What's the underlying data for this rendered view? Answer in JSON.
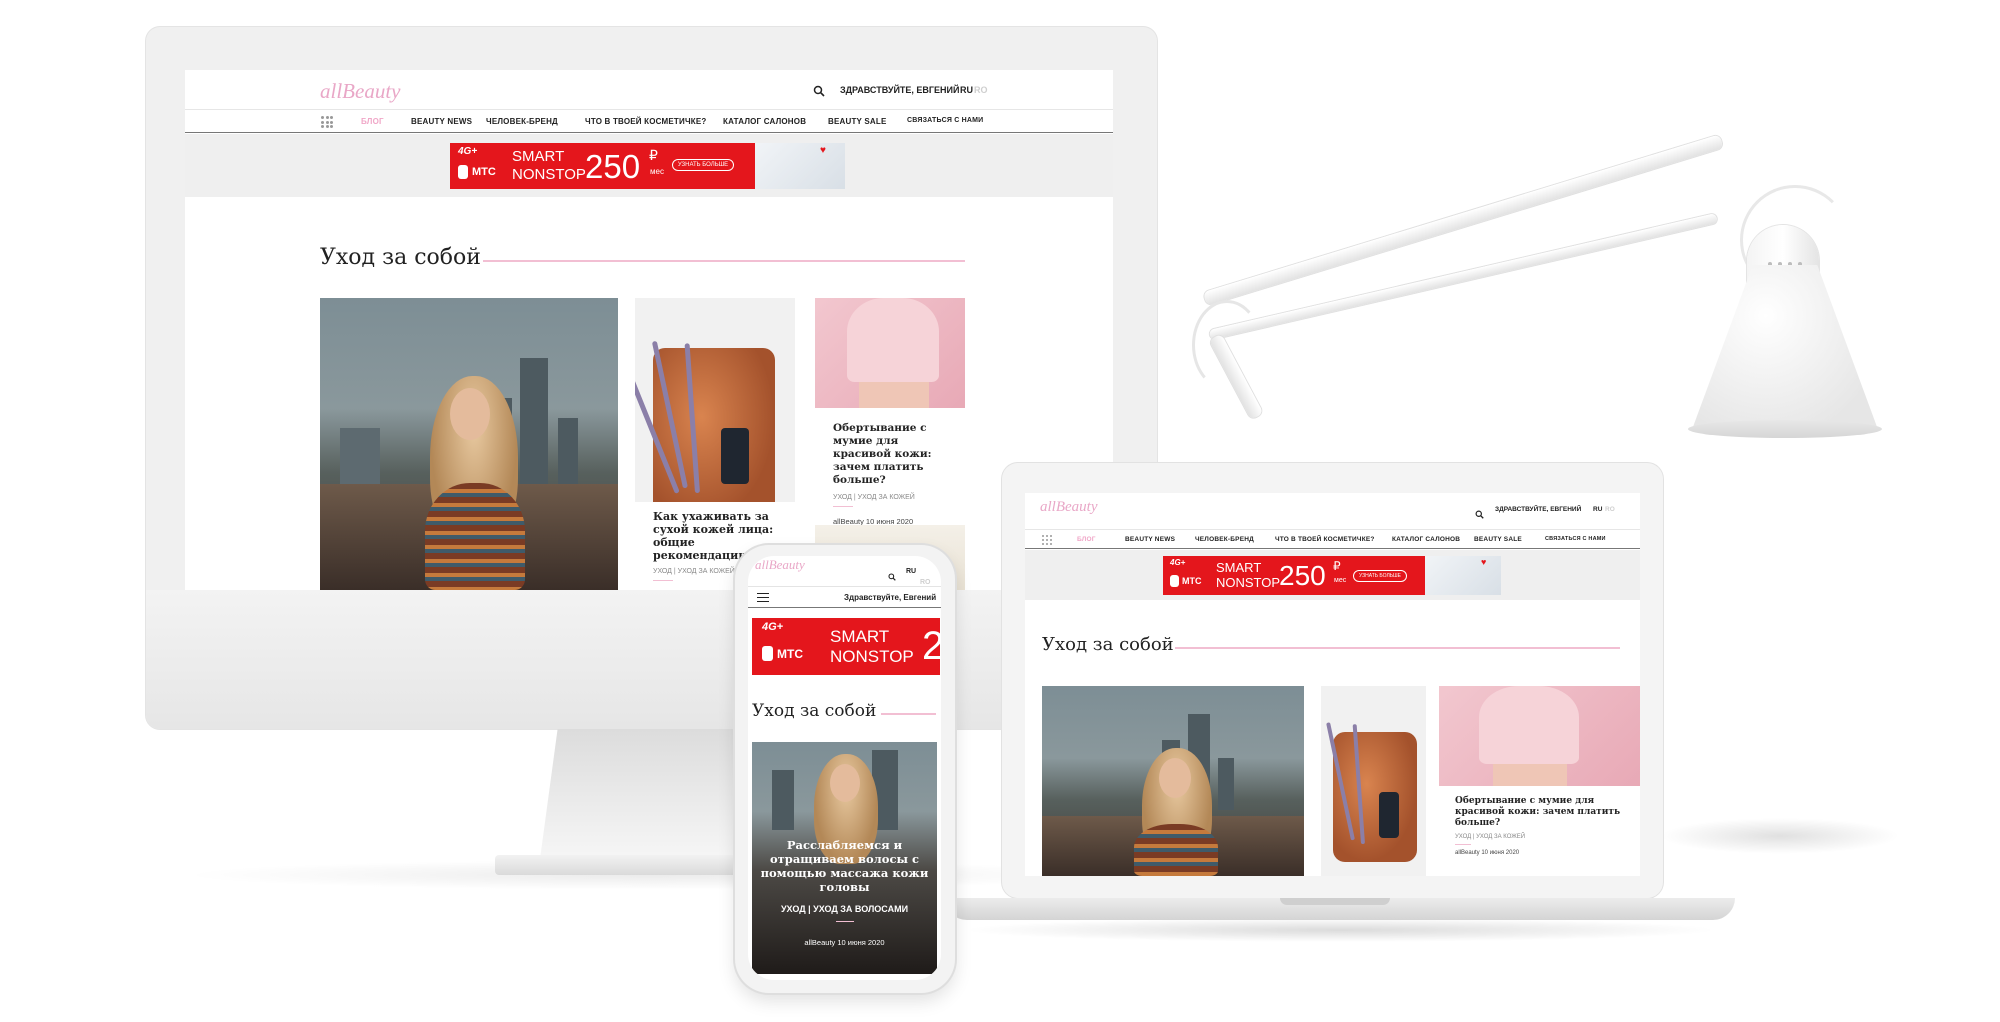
{
  "site": {
    "logo": "allBeauty",
    "greeting_upper": "ЗДРАВСТВУЙТЕ, ЕВГЕНИЙ",
    "greeting_mobile": "Здравствуйте, Евгений",
    "lang_active": "RU",
    "lang_other": "RO",
    "nav": [
      {
        "label": "БЛОГ",
        "active": true
      },
      {
        "label": "BEAUTY NEWS"
      },
      {
        "label": "ЧЕЛОВЕК-БРЕНД"
      },
      {
        "label": "ЧТО В ТВОЕЙ КОСМЕТИЧКЕ?"
      },
      {
        "label": "КАТАЛОГ САЛОНОВ"
      },
      {
        "label": "BEAUTY SALE"
      },
      {
        "label": "СВЯЗАТЬСЯ С НАМИ"
      }
    ],
    "ad": {
      "badge": "4G+",
      "brand": "МТС",
      "line1": "SMART",
      "line2": "NONSTOP",
      "price": "250",
      "currency": "₽",
      "per": "мес",
      "cta": "УЗНАТЬ БОЛЬШЕ",
      "price_partial_mobile": "2"
    },
    "section_title": "Уход за собой",
    "articles": [
      {
        "title": "Как ухаживать за сухой кожей лица: общие рекомендации",
        "category": "УХОД | УХОД ЗА КОЖЕЙ"
      },
      {
        "title": "Обертывание с мумие для красивой кожи: зачем платить больше?",
        "category": "УХОД | УХОД ЗА КОЖЕЙ",
        "meta": "allBeauty 10 июня 2020"
      },
      {
        "title": "Расслабляемся и отращиваем волосы с помощью массажа кожи головы",
        "category": "УХОД | УХОД ЗА ВОЛОСАМИ",
        "meta": "allBeauty 10 июня 2020"
      }
    ]
  },
  "colors": {
    "accent_pink": "#f0a6c7",
    "ad_red": "#e4161c",
    "logo_blue": "#9fd3e6"
  },
  "icons": [
    "search-icon",
    "grid-menu-icon",
    "hamburger-menu-icon",
    "heart-icon"
  ]
}
